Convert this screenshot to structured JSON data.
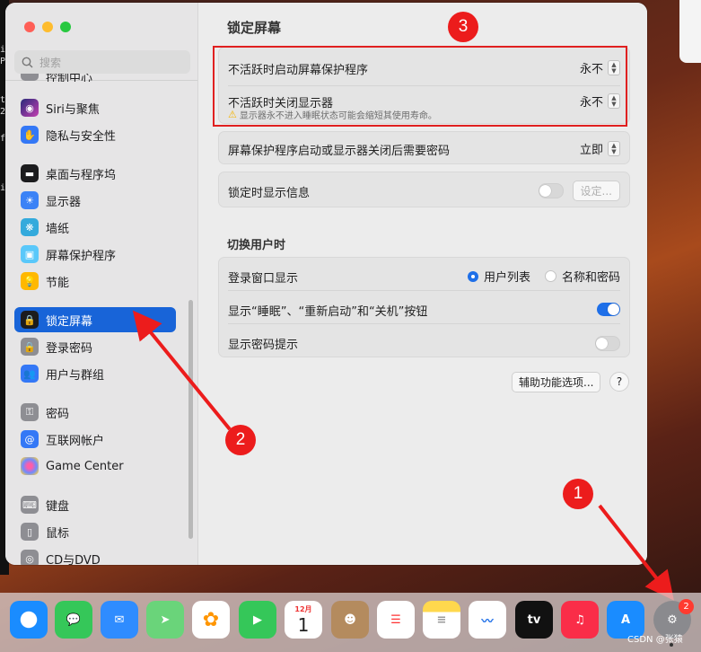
{
  "terminal_fragments": [
    "i",
    "P",
    "t",
    "2",
    "f",
    "i"
  ],
  "sidebar": {
    "search_placeholder": "搜索",
    "cut_item": "控制中心",
    "items": [
      {
        "label": "Siri与聚焦",
        "icon": "siri-icon"
      },
      {
        "label": "隐私与安全性",
        "icon": "hand-icon"
      },
      {
        "label": "桌面与程序坞",
        "icon": "dock-icon"
      },
      {
        "label": "显示器",
        "icon": "sun-icon"
      },
      {
        "label": "墙纸",
        "icon": "wallpaper-icon"
      },
      {
        "label": "屏幕保护程序",
        "icon": "screensaver-icon"
      },
      {
        "label": "节能",
        "icon": "lightbulb-icon"
      },
      {
        "label": "锁定屏幕",
        "icon": "lock-icon",
        "selected": true
      },
      {
        "label": "登录密码",
        "icon": "lock-icon"
      },
      {
        "label": "用户与群组",
        "icon": "users-icon"
      },
      {
        "label": "密码",
        "icon": "key-icon"
      },
      {
        "label": "互联网帐户",
        "icon": "at-icon"
      },
      {
        "label": "Game Center",
        "icon": "gamecenter-icon"
      },
      {
        "label": "键盘",
        "icon": "keyboard-icon"
      },
      {
        "label": "鼠标",
        "icon": "mouse-icon"
      },
      {
        "label": "CD与DVD",
        "icon": "disc-icon"
      }
    ]
  },
  "main": {
    "title": "锁定屏幕",
    "screensaver_label": "不活跃时启动屏幕保护程序",
    "screensaver_value": "永不",
    "display_off_label": "不活跃时关闭显示器",
    "display_off_value": "永不",
    "display_warning": "显示器永不进入睡眠状态可能会缩短其使用寿命。",
    "password_label": "屏幕保护程序启动或显示器关闭后需要密码",
    "password_value": "立即",
    "lockinfo_label": "锁定时显示信息",
    "lockinfo_enabled": false,
    "settings_button": "设定...",
    "section_title": "切换用户时",
    "login_window_label": "登录窗口显示",
    "radio_user_list": "用户列表",
    "radio_name_password": "名称和密码",
    "selected_radio": "用户列表",
    "power_buttons_label": "显示“睡眠”、“重新启动”和“关机”按钮",
    "power_buttons_enabled": true,
    "password_hint_label": "显示密码提示",
    "password_hint_enabled": false,
    "accessibility_button": "辅助功能选项...",
    "help_button": "?"
  },
  "annotations": {
    "badge1": "1",
    "badge2": "2",
    "badge3": "3"
  },
  "dock": {
    "calendar_month": "12月",
    "calendar_day": "1",
    "tv_label": "tv",
    "settings_badge": "2",
    "icons": [
      "safari-icon",
      "messages-icon",
      "mail-icon",
      "maps-icon",
      "photos-icon",
      "facetime-icon",
      "calendar-icon",
      "contacts-icon",
      "reminders-icon",
      "notes-icon",
      "freeform-icon",
      "appletv-icon",
      "music-icon",
      "appstore-icon",
      "system-settings-icon"
    ]
  },
  "watermark": "CSDN @张猿",
  "colors": {
    "accent": "#1864d8",
    "annotation_red": "#e02020",
    "selected_bg": "#1864d8"
  }
}
